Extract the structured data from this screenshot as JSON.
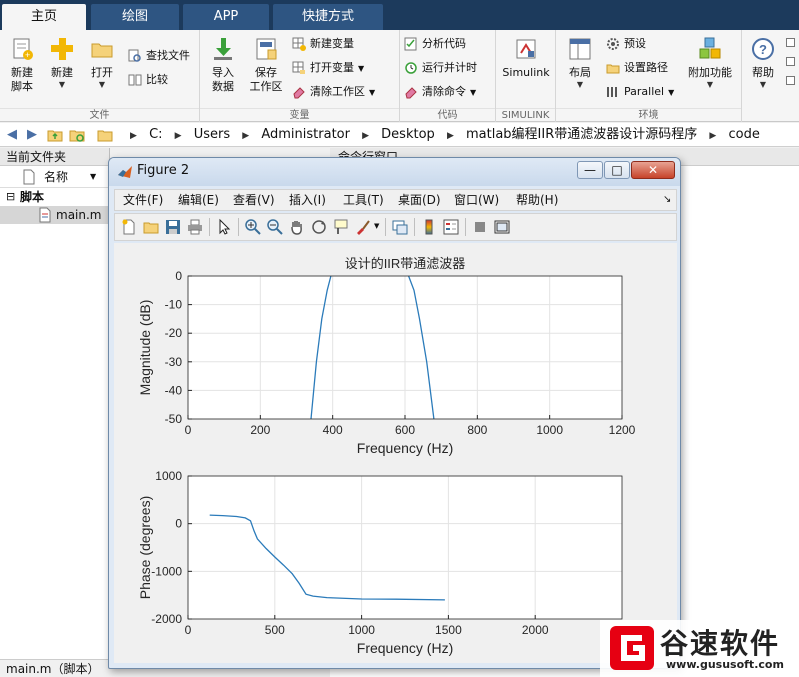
{
  "ribbon": {
    "tabs": [
      "主页",
      "绘图",
      "APP",
      "快捷方式"
    ],
    "sections": {
      "file": "文件",
      "variable": "变量",
      "code": "代码",
      "simulink": "SIMULINK",
      "environment": "环境"
    },
    "buttons": {
      "new_script": "新建\n脚本",
      "new": "新建",
      "open": "打开",
      "find_files": "查找文件",
      "compare": "比较",
      "import_data": "导入\n数据",
      "save_workspace": "保存\n工作区",
      "new_variable": "新建变量",
      "open_variable": "打开变量",
      "clear_workspace": "清除工作区",
      "analyze_code": "分析代码",
      "run_and_time": "运行并计时",
      "clear_commands": "清除命令",
      "simulink": "Simulink",
      "layout": "布局",
      "preferences": "预设",
      "set_path": "设置路径",
      "parallel": "Parallel",
      "addons": "附加功能",
      "help": "帮助"
    }
  },
  "address": {
    "crumbs": [
      "C:",
      "Users",
      "Administrator",
      "Desktop",
      "matlab编程IIR带通滤波器设计源码程序",
      "code"
    ]
  },
  "left_panel": {
    "title": "当前文件夹",
    "column_name": "名称",
    "folder": "脚本",
    "file": "main.m",
    "status": "main.m（脚本）"
  },
  "right_panel": {
    "title": "命令行窗口"
  },
  "figure": {
    "title": "Figure 2",
    "menu": [
      "文件(F)",
      "编辑(E)",
      "查看(V)",
      "插入(I)",
      "工具(T)",
      "桌面(D)",
      "窗口(W)",
      "帮助(H)"
    ]
  },
  "watermark": {
    "brand": "谷速软件",
    "url": "www.gususoft.com"
  },
  "colors": {
    "line": "#2b7bba",
    "tabbar": "#1c3a5c"
  },
  "chart_data": [
    {
      "type": "line",
      "title": "设计的IIR带通滤波器",
      "xlabel": "Frequency (Hz)",
      "ylabel": "Magnitude (dB)",
      "xlim": [
        0,
        1200
      ],
      "ylim": [
        -50,
        0
      ],
      "xticks": [
        0,
        200,
        400,
        600,
        800,
        1000,
        1200
      ],
      "yticks": [
        0,
        -10,
        -20,
        -30,
        -40,
        -50
      ],
      "grid": true,
      "series": [
        {
          "x": [
            340,
            355,
            370,
            385,
            395
          ],
          "y": [
            -50,
            -30,
            -15,
            -5,
            0
          ]
        },
        {
          "x": [
            610,
            625,
            640,
            660,
            680
          ],
          "y": [
            0,
            -5,
            -15,
            -30,
            -50
          ]
        }
      ]
    },
    {
      "type": "line",
      "title": "",
      "xlabel": "Frequency (Hz)",
      "ylabel": "Phase (degrees)",
      "xlim": [
        0,
        2500
      ],
      "ylim": [
        -2000,
        1000
      ],
      "xticks": [
        0,
        500,
        1000,
        1500,
        2000
      ],
      "yticks": [
        1000,
        0,
        -1000,
        -2000
      ],
      "grid": true,
      "series": [
        {
          "x": [
            125,
            200,
            280,
            330,
            360,
            380,
            400,
            450,
            500,
            550,
            600,
            640,
            680,
            720,
            800,
            1000,
            1200,
            1480
          ],
          "y": [
            180,
            170,
            150,
            120,
            60,
            -150,
            -320,
            -520,
            -700,
            -870,
            -1050,
            -1250,
            -1480,
            -1520,
            -1550,
            -1580,
            -1585,
            -1600
          ]
        }
      ]
    }
  ]
}
